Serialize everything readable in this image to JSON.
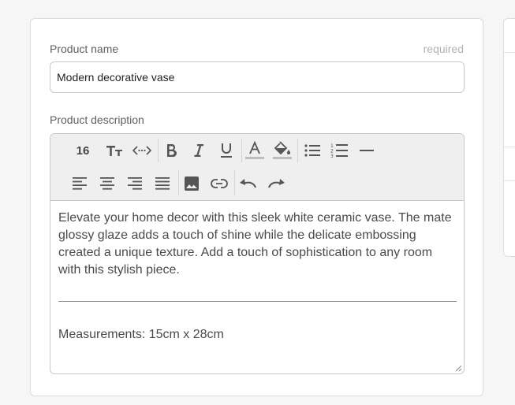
{
  "product_name": {
    "label": "Product name",
    "required_text": "required",
    "value": "Modern decorative vase"
  },
  "description": {
    "label": "Product description",
    "toolbar": {
      "font_size": "16",
      "row1_icons": [
        "text-size-icon",
        "code-icon",
        "bold-icon",
        "italic-icon",
        "underline-icon",
        "font-color-icon",
        "highlight-icon",
        "bulleted-list-icon",
        "numbered-list-icon",
        "horizontal-rule-icon"
      ],
      "row2_icons": [
        "align-left-icon",
        "align-center-icon",
        "align-right-icon",
        "align-justify-icon",
        "image-icon",
        "link-icon",
        "undo-icon",
        "redo-icon"
      ]
    },
    "body_text": "Elevate your home decor with this sleek white ceramic vase. The mate glossy glaze adds a touch of shine while the delicate embossing created a unique texture. Add a touch of sophistication to any room with this stylish piece.",
    "measurements": "Measurements: 15cm x 28cm"
  },
  "colors": {
    "font_color_bar": "#bdbdbd",
    "highlight_bar": "#bdbdbd"
  }
}
